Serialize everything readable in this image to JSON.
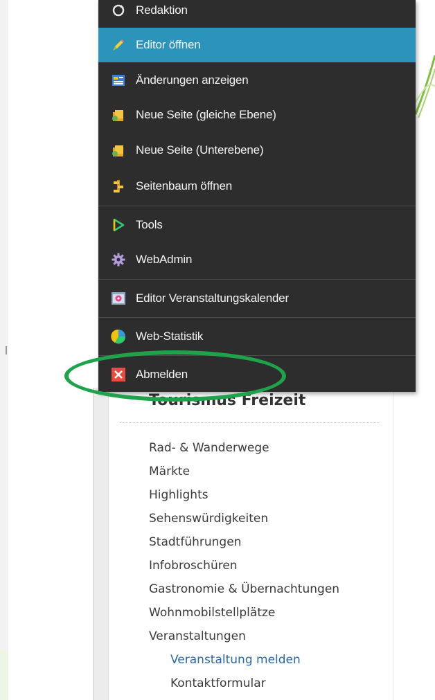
{
  "menu": {
    "items": [
      {
        "label": "Redaktion",
        "icon": "refresh-icon"
      },
      {
        "label": "Editor öffnen",
        "icon": "pencil-icon",
        "active": true
      },
      {
        "label": "Änderungen anzeigen",
        "icon": "changes-list-icon"
      },
      {
        "label": "Neue Seite (gleiche Ebene)",
        "icon": "new-page-icon"
      },
      {
        "label": "Neue Seite (Unterebene)",
        "icon": "new-subpage-icon"
      },
      {
        "label": "Seitenbaum öffnen",
        "icon": "page-tree-icon"
      },
      {
        "label": "Tools",
        "icon": "tools-play-icon"
      },
      {
        "label": "WebAdmin",
        "icon": "gear-icon"
      },
      {
        "label": "Editor Veranstaltungskalender",
        "icon": "calendar-icon"
      },
      {
        "label": "Web-Statistik",
        "icon": "pie-chart-icon"
      },
      {
        "label": "Abmelden",
        "icon": "close-icon"
      }
    ],
    "active_color": "#2c93ba",
    "background": "#2d2d2d"
  },
  "annotation": {
    "ring_color": "#1ea34a",
    "target": "Abmelden"
  },
  "sidebar": {
    "title": "Tourismus Freizeit",
    "items": [
      {
        "label": "Rad- & Wanderwege"
      },
      {
        "label": "Märkte"
      },
      {
        "label": "Highlights"
      },
      {
        "label": "Sehenswürdigkeiten"
      },
      {
        "label": "Stadtführungen"
      },
      {
        "label": "Infobroschüren"
      },
      {
        "label": "Gastronomie & Übernachtungen"
      },
      {
        "label": "Wohnmobilstellplätze"
      },
      {
        "label": "Veranstaltungen"
      },
      {
        "label": "Veranstaltung melden",
        "sub": true,
        "active": true
      },
      {
        "label": "Kontaktformular",
        "sub": true
      }
    ],
    "link_color": "#2a67a6"
  }
}
